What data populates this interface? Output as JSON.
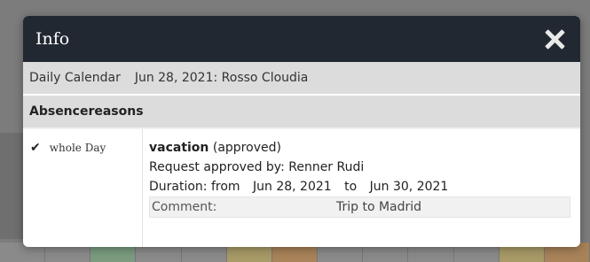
{
  "modal": {
    "title": "Info"
  },
  "subheader": {
    "calendar_name": "Daily Calendar",
    "date_person": "Jun 28, 2021: Rosso Cloudia"
  },
  "section": {
    "title": "Absencereasons"
  },
  "entry": {
    "icon": "checkmark-icon",
    "time": "whole Day",
    "reason": "vacation",
    "status": "(approved)",
    "approved_by": "Request approved by: Renner Rudi",
    "duration_prefix": "Duration: from",
    "date_from": "Jun 28, 2021",
    "to": "to",
    "date_to": "Jun 30, 2021",
    "comment_label": "Comment:",
    "comment_value": "Trip to Madrid"
  },
  "colors": {
    "header_bg": "#222831",
    "section_bg": "#dcdcdc",
    "overlay": "#7c7c7c"
  }
}
